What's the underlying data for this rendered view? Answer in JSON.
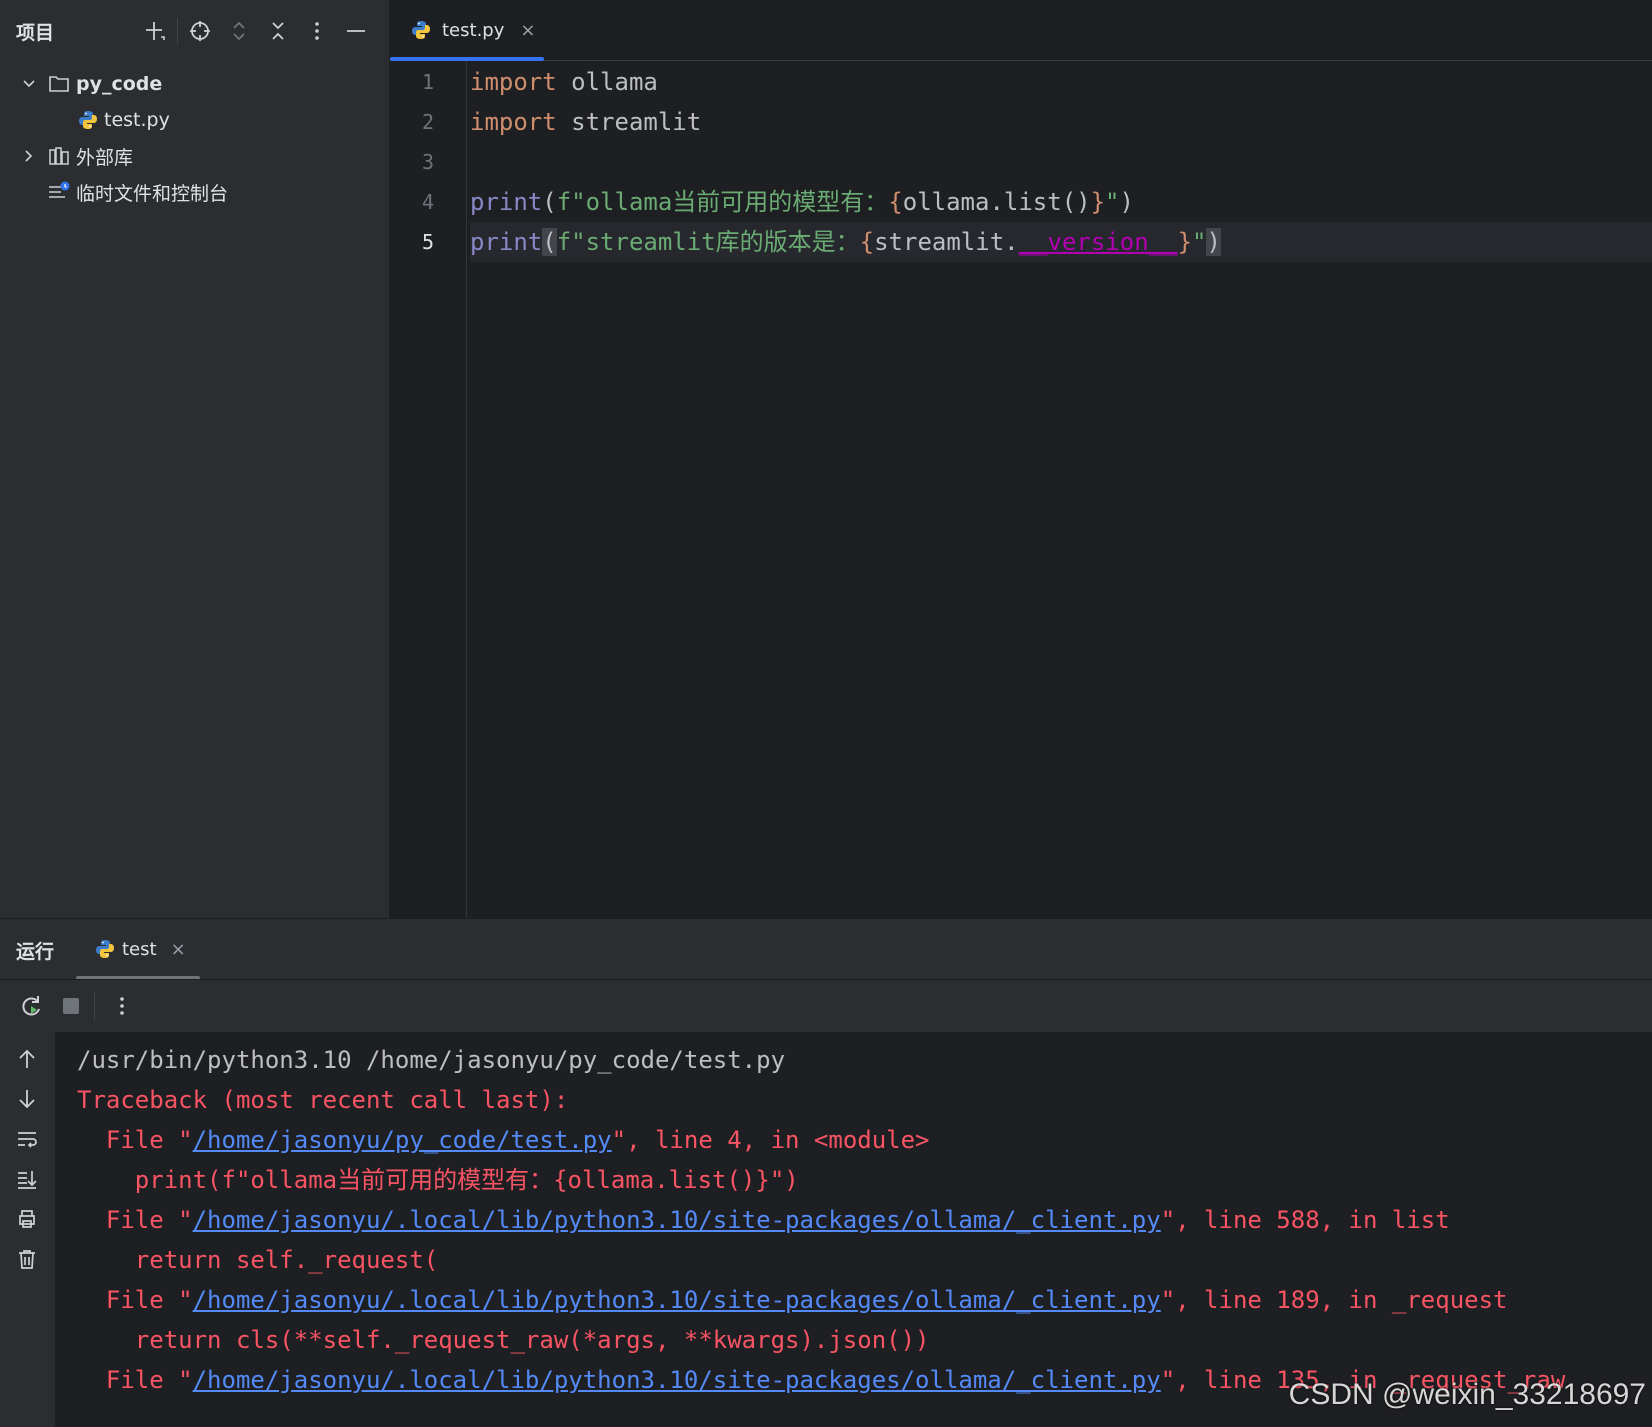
{
  "project_pane": {
    "title": "项目",
    "tree": [
      {
        "label": "py_code",
        "type": "folder",
        "expanded": true
      },
      {
        "label": "test.py",
        "type": "python-file"
      },
      {
        "label": "外部库",
        "type": "library",
        "expanded": false
      },
      {
        "label": "临时文件和控制台",
        "type": "scratches"
      }
    ]
  },
  "editor": {
    "tab": {
      "label": "test.py",
      "close": "×"
    },
    "line_numbers": [
      "1",
      "2",
      "3",
      "4",
      "5"
    ],
    "current_line": "5",
    "lines": [
      {
        "t1": "import",
        "t2": " ollama"
      },
      {
        "t1": "import",
        "t2": " streamlit"
      },
      {},
      {
        "t1": "print",
        "t2": "(",
        "t3": "f\"ollama当前可用的模型有：",
        "t4": "{",
        "t5": "ollama.list()",
        "t6": "}",
        "t7": "\"",
        "t8": ")"
      },
      {
        "t1": "print",
        "t2": "(",
        "t3": "f\"streamlit库的版本是：",
        "t4": "{",
        "t5": "streamlit.",
        "t6": "__version__",
        "t7": "}",
        "t8": "\"",
        "t9": ")"
      }
    ]
  },
  "run_panel": {
    "title": "运行",
    "tab": {
      "label": "test",
      "close": "×"
    },
    "console": [
      {
        "text": "/usr/bin/python3.10 /home/jasonyu/py_code/test.py"
      },
      {
        "text": "Traceback (most recent call last):"
      },
      {
        "pre": "  File \"",
        "link": "/home/jasonyu/py_code/test.py",
        "post": "\", line 4, in <module>"
      },
      {
        "text": "    print(f\"ollama当前可用的模型有：{ollama.list()}\")"
      },
      {
        "pre": "  File \"",
        "link": "/home/jasonyu/.local/lib/python3.10/site-packages/ollama/_client.py",
        "post": "\", line 588, in list"
      },
      {
        "text": "    return self._request("
      },
      {
        "pre": "  File \"",
        "link": "/home/jasonyu/.local/lib/python3.10/site-packages/ollama/_client.py",
        "post": "\", line 189, in _request"
      },
      {
        "text": "    return cls(**self._request_raw(*args, **kwargs).json())"
      },
      {
        "pre": "  File \"",
        "link": "/home/jasonyu/.local/lib/python3.10/site-packages/ollama/_client.py",
        "post": "\", line 135, in _request_raw"
      }
    ]
  },
  "watermark": "CSDN @weixin_33218697",
  "colors": {
    "accent": "#3574f0",
    "error": "#f75464",
    "link": "#548af7",
    "keyword": "#cf8e6d",
    "string": "#6aab73"
  }
}
